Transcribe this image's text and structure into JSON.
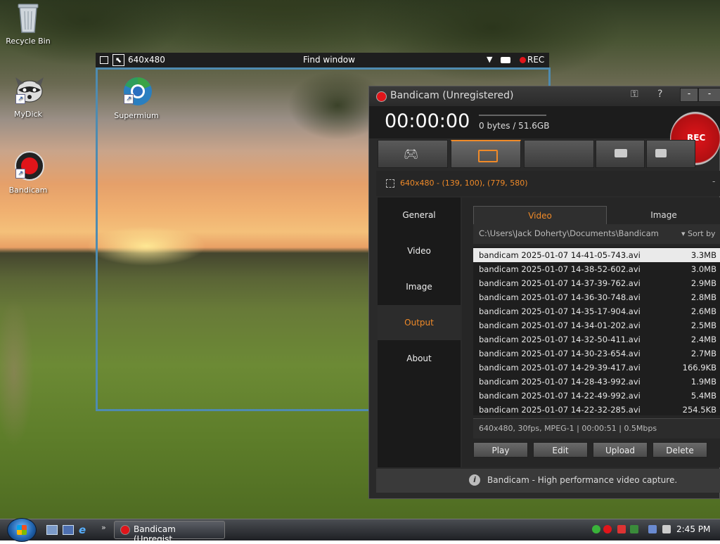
{
  "desktop": {
    "icons": [
      {
        "label": "Recycle Bin"
      },
      {
        "label": "MyDick"
      },
      {
        "label": "Supermium"
      },
      {
        "label": "Bandicam"
      }
    ]
  },
  "capture_bar": {
    "size_label": "640x480",
    "title": "Find window",
    "rec_label": "REC"
  },
  "bandicam": {
    "title": "Bandicam (Unregistered)",
    "timer": "00:00:00",
    "storage": "0 bytes / 51.6GB",
    "rec_button": "REC",
    "region": "640x480 - (139, 100), (779, 580)",
    "sidebar": [
      "General",
      "Video",
      "Image",
      "Output",
      "About"
    ],
    "sidebar_active": "Output",
    "content_tabs": [
      "Video",
      "Image"
    ],
    "path": "C:\\Users\\Jack Doherty\\Documents\\Bandicam",
    "sort_label": "Sort by",
    "files": [
      {
        "name": "bandicam 2025-01-07 14-41-05-743.avi",
        "size": "3.3MB"
      },
      {
        "name": "bandicam 2025-01-07 14-38-52-602.avi",
        "size": "3.0MB"
      },
      {
        "name": "bandicam 2025-01-07 14-37-39-762.avi",
        "size": "2.9MB"
      },
      {
        "name": "bandicam 2025-01-07 14-36-30-748.avi",
        "size": "2.8MB"
      },
      {
        "name": "bandicam 2025-01-07 14-35-17-904.avi",
        "size": "2.6MB"
      },
      {
        "name": "bandicam 2025-01-07 14-34-01-202.avi",
        "size": "2.5MB"
      },
      {
        "name": "bandicam 2025-01-07 14-32-50-411.avi",
        "size": "2.4MB"
      },
      {
        "name": "bandicam 2025-01-07 14-30-23-654.avi",
        "size": "2.7MB"
      },
      {
        "name": "bandicam 2025-01-07 14-29-39-417.avi",
        "size": "166.9KB"
      },
      {
        "name": "bandicam 2025-01-07 14-28-43-992.avi",
        "size": "1.9MB"
      },
      {
        "name": "bandicam 2025-01-07 14-22-49-992.avi",
        "size": "5.4MB"
      },
      {
        "name": "bandicam 2025-01-07 14-22-32-285.avi",
        "size": "254.5KB"
      }
    ],
    "file_info": "640x480, 30fps, MPEG-1 | 00:00:51 | 0.5Mbps",
    "actions": [
      "Play",
      "Edit",
      "Upload",
      "Delete"
    ],
    "footer": "Bandicam - High performance video capture."
  },
  "taskbar": {
    "task_label": "Bandicam (Unregist...",
    "clock": "2:45 PM"
  },
  "colors": {
    "accent_orange": "#f08a28",
    "rec_red": "#c81a1a",
    "frame_blue": "#4f8bb0"
  }
}
